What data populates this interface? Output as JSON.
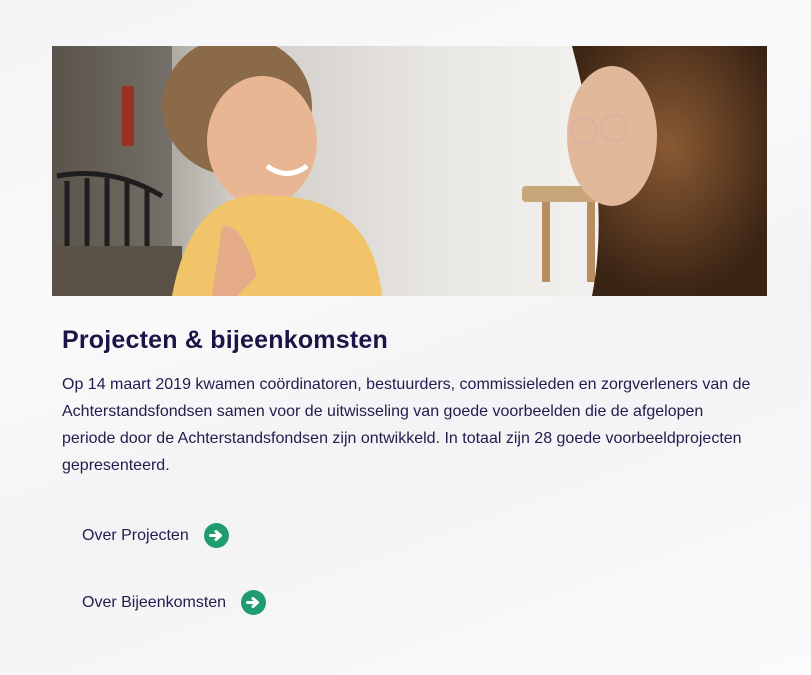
{
  "hero": {
    "image": "photo-two-women-talking"
  },
  "section": {
    "title": "Projecten & bijeenkomsten",
    "intro": "Op 14 maart 2019 kwamen coördinatoren, bestuurders, commissieleden en zorgverleners van de Achterstandsfondsen samen voor de uitwisseling van goede voorbeelden die de afgelopen periode door de Achterstandsfondsen zijn ontwikkeld. In totaal zijn 28 goede voorbeeldprojecten gepresenteerd."
  },
  "links": [
    {
      "label": "Over Projecten",
      "icon": "arrow-right-circle-icon"
    },
    {
      "label": "Over Bijeenkomsten",
      "icon": "arrow-right-circle-icon"
    }
  ],
  "colors": {
    "heading": "#1c1446",
    "text": "#231b4d",
    "accent": "#1f9d6e"
  }
}
